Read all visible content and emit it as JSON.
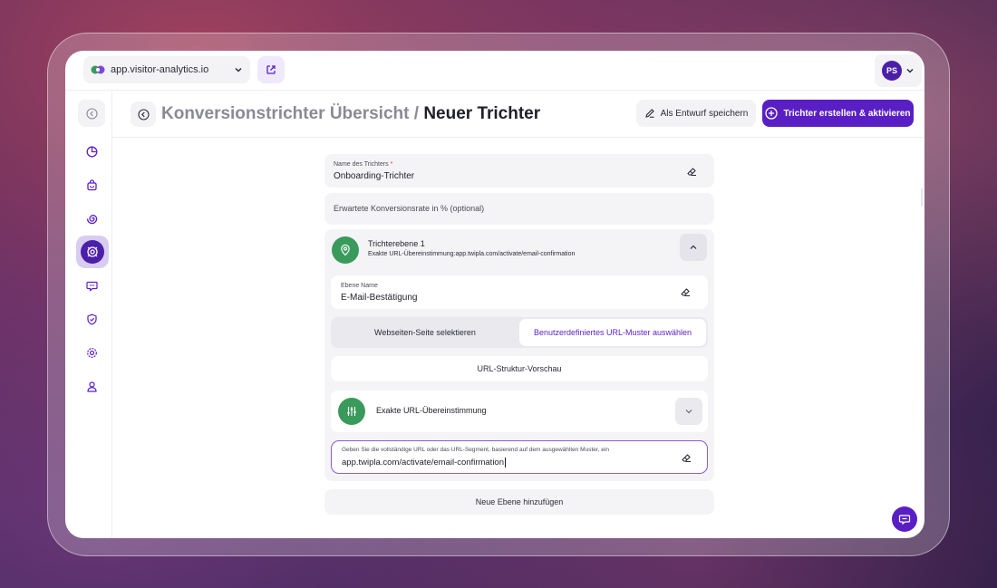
{
  "topbar": {
    "site": "app.visitor-analytics.io",
    "site_icon": "site-logo-icon",
    "external_icon": "external-link-icon",
    "user_initials": "PS"
  },
  "sidebar": {
    "items": [
      {
        "icon": "collapse-icon"
      },
      {
        "icon": "dashboard-icon"
      },
      {
        "icon": "bag-icon"
      },
      {
        "icon": "spiral-icon"
      },
      {
        "icon": "funnel-target-icon",
        "active": true
      },
      {
        "icon": "chat-screen-icon"
      },
      {
        "icon": "shield-icon"
      },
      {
        "icon": "gear-icon"
      },
      {
        "icon": "user-location-icon"
      }
    ]
  },
  "header": {
    "breadcrumb": "Konversionstrichter Übersicht",
    "separator": " / ",
    "current": "Neuer Trichter",
    "draft_label": "Als Entwurf speichern",
    "create_label": "Trichter erstellen & aktivieren"
  },
  "form": {
    "name_label": "Name des Trichters",
    "name_required": "*",
    "name_value": "Onboarding-Trichter",
    "rate_placeholder": "Erwartete Konversionsrate in % (optional)",
    "level": {
      "title": "Trichterebene 1",
      "subtitle": "Exakte URL-Übereinstimmung:app.twipla.com/activate/email-confirmation",
      "level_name_label": "Ebene Name",
      "level_name_value": "E-Mail-Bestätigung",
      "toggle_left": "Webseiten-Seite selektieren",
      "toggle_right": "Benutzerdefiniertes URL-Muster auswählen",
      "preview_label": "URL-Struktur-Vorschau",
      "match_label": "Exakte URL-Übereinstimmung",
      "url_hint": "Geben Sie die vollständige URL oder das URL-Segment, basierend auf dem ausgewählten Muster, ein",
      "url_value": "app.twipla.com/activate/email-confirmation"
    },
    "add_level_label": "Neue Ebene hinzufügen"
  },
  "colors": {
    "accent": "#5a1fc4",
    "success": "#3a9a5c"
  }
}
